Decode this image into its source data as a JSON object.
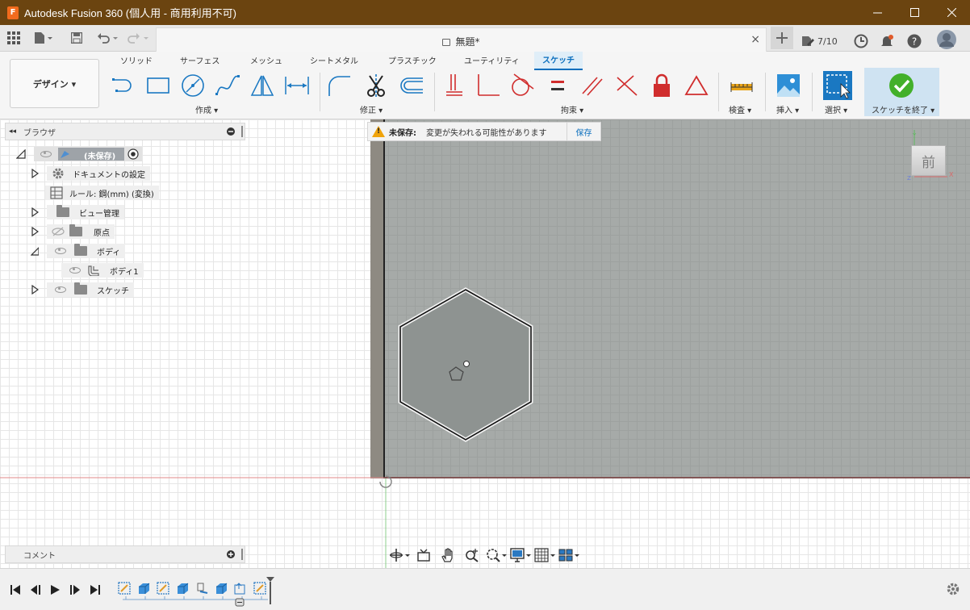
{
  "window": {
    "title": "Autodesk Fusion 360 (個人用 - 商用利用不可)",
    "app_icon_letter": "F",
    "controls": [
      "minimize-icon",
      "maximize-icon",
      "close-icon"
    ]
  },
  "quickbar": {
    "doc_title": "無題*",
    "doc_close": "×",
    "jobs_count": "7/10"
  },
  "ribbon": {
    "workspace": "デザイン ▾",
    "tabs": [
      "ソリッド",
      "サーフェス",
      "メッシュ",
      "シートメタル",
      "プラスチック",
      "ユーティリティ",
      "スケッチ"
    ],
    "active_tab": "スケッチ",
    "groups": {
      "create": "作成 ▾",
      "modify": "修正 ▾",
      "constraints": "拘束 ▾",
      "inspect": "検査 ▾",
      "insert": "挿入 ▾",
      "select": "選択 ▾",
      "finish": "スケッチを終了 ▾"
    }
  },
  "browser": {
    "title": "ブラウザ",
    "collapse": "◂◂",
    "tree": {
      "root": "(未保存)",
      "document_settings": "ドキュメントの設定",
      "units": "ルール: 鋼(mm) (変換)",
      "named_views": "ビュー管理",
      "origin": "原点",
      "bodies": "ボディ",
      "body1": "ボディ1",
      "sketches": "スケッチ"
    }
  },
  "comments": {
    "title": "コメント"
  },
  "banner": {
    "unsaved_label": "未保存:",
    "message": "変更が失われる可能性があります",
    "save": "保存"
  },
  "viewcube": {
    "face": "前",
    "axis_x": "X",
    "axis_y": "Y",
    "axis_z": "Z"
  },
  "colors": {
    "titlebar": "#6b4410",
    "accent": "#0a6ebd",
    "finish_check": "#43b02a",
    "constraint_red": "#d02d2d",
    "body_fill": "#a6aaa8"
  }
}
